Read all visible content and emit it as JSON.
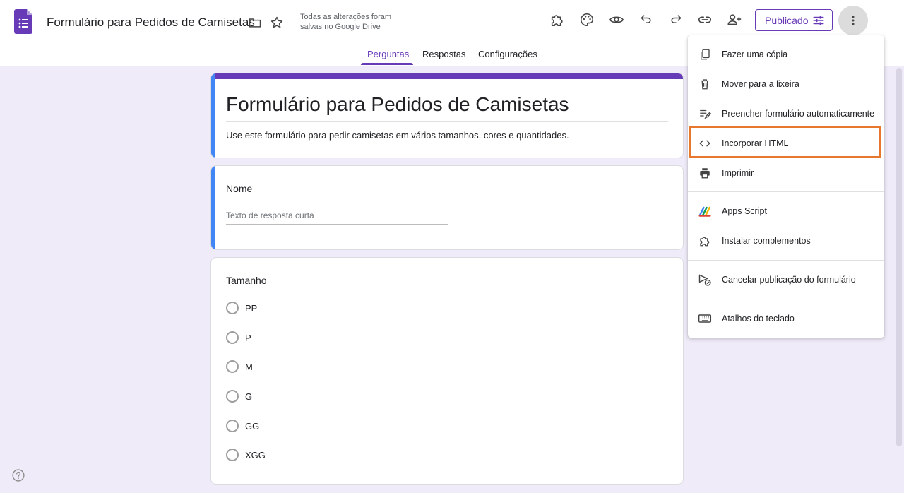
{
  "header": {
    "doc_title": "Formulário para Pedidos de Camisetas",
    "save_status": "Todas as alterações foram salvas no Google Drive",
    "publish_label": "Publicado",
    "accent_color": "#673ab7"
  },
  "tabs": [
    {
      "label": "Perguntas",
      "active": true
    },
    {
      "label": "Respostas",
      "active": false
    },
    {
      "label": "Configurações",
      "active": false
    }
  ],
  "form": {
    "title": "Formulário para Pedidos de Camisetas",
    "description": "Use este formulário para pedir camisetas em vários tamanhos, cores e quantidades.",
    "questions": [
      {
        "title": "Nome",
        "placeholder": "Texto de resposta curta"
      },
      {
        "title": "Tamanho",
        "options": [
          "PP",
          "P",
          "M",
          "G",
          "GG",
          "XGG"
        ]
      }
    ]
  },
  "menu": {
    "items": [
      {
        "label": "Fazer uma cópia",
        "icon": "copy-icon"
      },
      {
        "label": "Mover para a lixeira",
        "icon": "trash-icon"
      },
      {
        "label": "Preencher formulário automaticamente",
        "icon": "autofill-icon"
      },
      {
        "label": "Incorporar HTML",
        "icon": "code-icon",
        "highlighted": true
      },
      {
        "label": "Imprimir",
        "icon": "print-icon"
      },
      {
        "label": "Apps Script",
        "icon": "apps-script-icon"
      },
      {
        "label": "Instalar complementos",
        "icon": "addon-icon"
      },
      {
        "label": "Cancelar publicação do formulário",
        "icon": "unpublish-icon"
      },
      {
        "label": "Atalhos do teclado",
        "icon": "keyboard-icon"
      }
    ]
  }
}
